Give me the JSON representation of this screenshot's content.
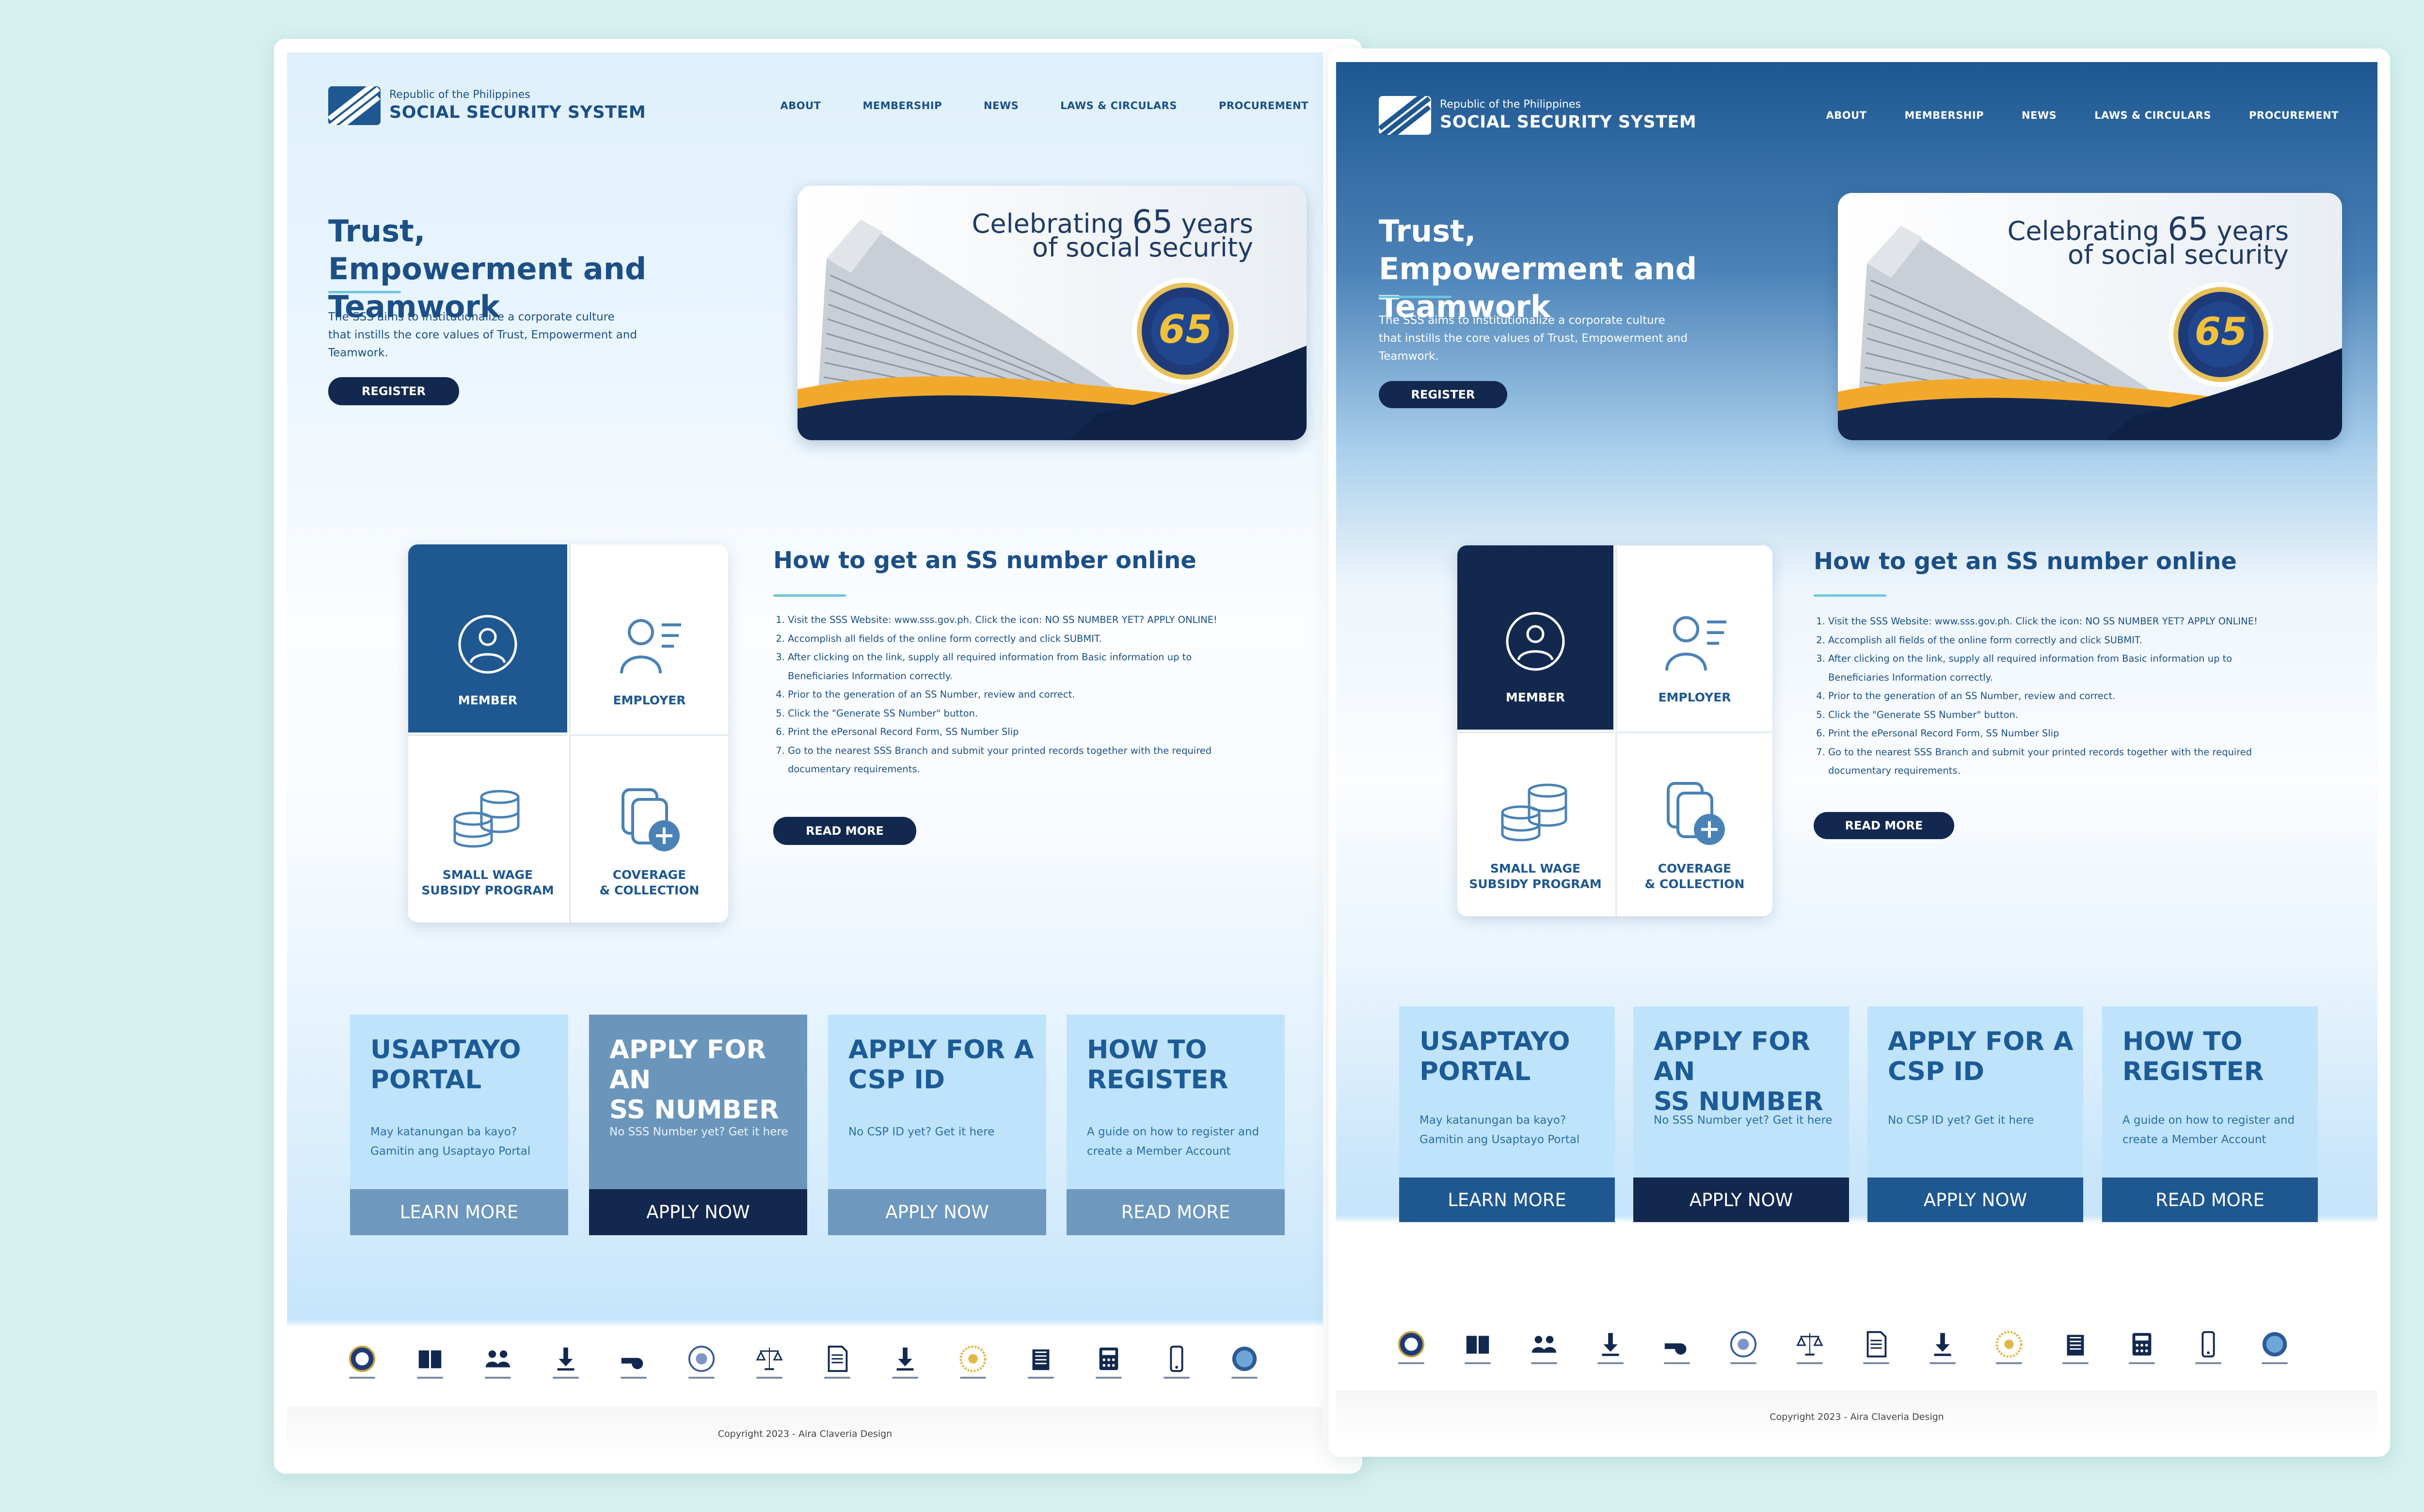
{
  "app": {
    "logo_sub": "Republic of the Philippines",
    "logo_main": "SOCIAL SECURITY SYSTEM"
  },
  "nav": [
    "ABOUT",
    "MEMBERSHIP",
    "NEWS",
    "LAWS & CIRCULARS",
    "PROCUREMENT"
  ],
  "hero": {
    "title": "Trust, Empowerment and Teamwork",
    "description": "The SSS aims to institutionalize a corporate culture that instills the core values of Trust, Empowerment and Teamwork.",
    "button": "REGISTER",
    "banner_line1_a": "Celebrating ",
    "banner_line1_b": "65",
    "banner_line1_c": " years",
    "banner_line2": "of social security",
    "badge_number": "65"
  },
  "services": [
    {
      "label": "MEMBER",
      "icon": "member-icon"
    },
    {
      "label": "EMPLOYER",
      "icon": "employer-icon"
    },
    {
      "label": "SMALL WAGE\nSUBSIDY PROGRAM",
      "icon": "coins-stack-icon"
    },
    {
      "label": "COVERAGE\n& COLLECTION",
      "icon": "add-document-icon"
    }
  ],
  "how_to": {
    "title": "How to get an SS number online",
    "steps": [
      "Visit the SSS Website: www.sss.gov.ph. Click the icon: NO SS NUMBER YET? APPLY ONLINE!",
      "Accomplish all fields of the online form correctly and click SUBMIT.",
      "After clicking on the link, supply all required information from Basic information up to Beneficiaries Information correctly.",
      "Prior to the generation of an SS Number, review and correct.",
      "Click the \"Generate SS Number\" button.",
      "Print the ePersonal Record Form, SS Number Slip",
      "Go to the nearest SSS Branch and submit your printed records together with the required documentary requirements."
    ],
    "button": "READ MORE"
  },
  "cards": [
    {
      "title": "USAPTAYO\nPORTAL",
      "desc": "May katanungan ba kayo? Gamitin ang Usaptayo Portal",
      "button": "LEARN MORE"
    },
    {
      "title": "APPLY FOR AN\nSS NUMBER",
      "desc": "No SSS Number yet? Get it here",
      "button": "APPLY NOW"
    },
    {
      "title": "APPLY FOR A\nCSP ID",
      "desc": "No CSP ID yet? Get it here",
      "button": "APPLY NOW"
    },
    {
      "title": "HOW TO\nREGISTER",
      "desc": "A guide on how to register and create a Member Account",
      "button": "READ MORE"
    }
  ],
  "footer_icons": [
    "seal-icon",
    "book-icon",
    "people-icon",
    "download-icon",
    "whistle-icon",
    "badge-icon",
    "scales-icon",
    "document-icon",
    "download-icon",
    "sun-seal-icon",
    "building-icon",
    "calculator-icon",
    "phone-icon",
    "globe-seal-icon"
  ],
  "footer": {
    "copyright": "Copyright 2023 - Aira Claveria Design"
  },
  "colors": {
    "background": "#d5f0ef",
    "navy": "#13284f",
    "brand_blue": "#1f5890",
    "light_card": "#bfe3fb",
    "accent_line": "#6cc7de",
    "gold": "#f0a92a"
  }
}
